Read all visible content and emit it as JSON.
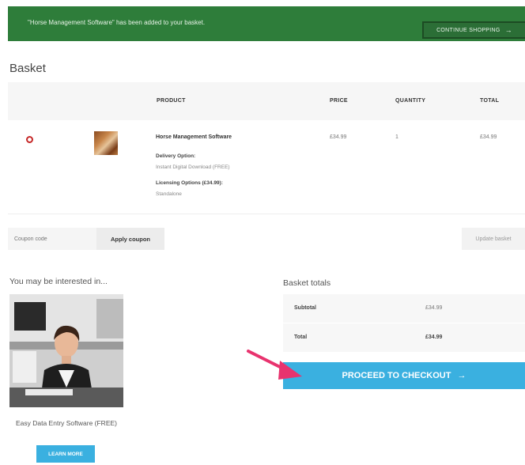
{
  "notice": {
    "message": "\"Horse Management Software\" has been added to your basket.",
    "continue_label": "CONTINUE SHOPPING",
    "continue_arrow": "→"
  },
  "page": {
    "title": "Basket"
  },
  "table": {
    "headers": {
      "product": "PRODUCT",
      "price": "PRICE",
      "quantity": "QUANTITY",
      "total": "TOTAL"
    },
    "items": [
      {
        "name": "Horse Management Software",
        "delivery_label": "Delivery Option:",
        "delivery_value": "Instant Digital Download (FREE)",
        "licensing_label": "Licensing Options (£34.99):",
        "licensing_value": "Standalone",
        "price": "£34.99",
        "quantity": "1",
        "total": "£34.99"
      }
    ]
  },
  "coupon": {
    "placeholder": "Coupon code",
    "apply_label": "Apply coupon",
    "update_label": "Update basket"
  },
  "interested": {
    "title": "You may be interested in...",
    "product_name": "Easy Data Entry Software (FREE)",
    "learn_more": "LEARN MORE"
  },
  "totals": {
    "title": "Basket totals",
    "subtotal_label": "Subtotal",
    "subtotal_value": "£34.99",
    "total_label": "Total",
    "total_value": "£34.99",
    "checkout_label": "PROCEED TO CHECKOUT",
    "checkout_arrow": "→"
  },
  "colors": {
    "notice_bg": "#2e7d3a",
    "accent": "#3ab0e0",
    "remove_icon": "#c62828",
    "annotation_arrow": "#e8336e"
  }
}
